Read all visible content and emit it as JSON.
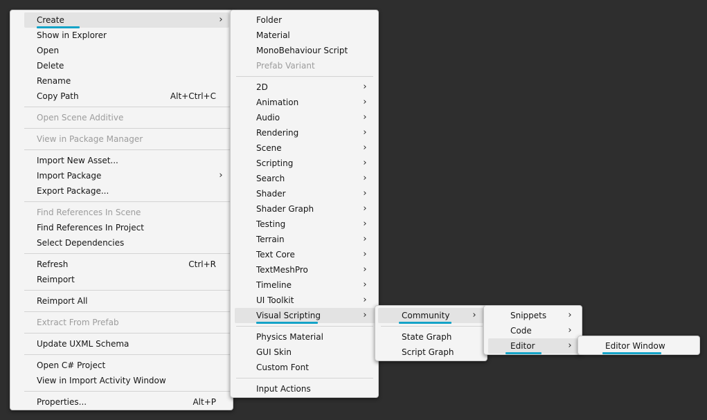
{
  "menus": {
    "main": {
      "items": [
        {
          "label": "Create",
          "submenu": true
        },
        {
          "label": "Show in Explorer"
        },
        {
          "label": "Open"
        },
        {
          "label": "Delete"
        },
        {
          "label": "Rename"
        },
        {
          "label": "Copy Path",
          "shortcut": "Alt+Ctrl+C"
        },
        {
          "label": "Open Scene Additive",
          "disabled": true
        },
        {
          "label": "View in Package Manager",
          "disabled": true
        },
        {
          "label": "Import New Asset..."
        },
        {
          "label": "Import Package",
          "submenu": true
        },
        {
          "label": "Export Package..."
        },
        {
          "label": "Find References In Scene",
          "disabled": true
        },
        {
          "label": "Find References In Project"
        },
        {
          "label": "Select Dependencies"
        },
        {
          "label": "Refresh",
          "shortcut": "Ctrl+R"
        },
        {
          "label": "Reimport"
        },
        {
          "label": "Reimport All"
        },
        {
          "label": "Extract From Prefab",
          "disabled": true
        },
        {
          "label": "Update UXML Schema"
        },
        {
          "label": "Open C# Project"
        },
        {
          "label": "View in Import Activity Window"
        },
        {
          "label": "Properties...",
          "shortcut": "Alt+P"
        }
      ]
    },
    "create": {
      "items": [
        {
          "label": "Folder"
        },
        {
          "label": "Material"
        },
        {
          "label": "MonoBehaviour Script"
        },
        {
          "label": "Prefab Variant",
          "disabled": true
        },
        {
          "label": "2D",
          "submenu": true
        },
        {
          "label": "Animation",
          "submenu": true
        },
        {
          "label": "Audio",
          "submenu": true
        },
        {
          "label": "Rendering",
          "submenu": true
        },
        {
          "label": "Scene",
          "submenu": true
        },
        {
          "label": "Scripting",
          "submenu": true
        },
        {
          "label": "Search",
          "submenu": true
        },
        {
          "label": "Shader",
          "submenu": true
        },
        {
          "label": "Shader Graph",
          "submenu": true
        },
        {
          "label": "Testing",
          "submenu": true
        },
        {
          "label": "Terrain",
          "submenu": true
        },
        {
          "label": "Text Core",
          "submenu": true
        },
        {
          "label": "TextMeshPro",
          "submenu": true
        },
        {
          "label": "Timeline",
          "submenu": true
        },
        {
          "label": "UI Toolkit",
          "submenu": true
        },
        {
          "label": "Visual Scripting",
          "submenu": true
        },
        {
          "label": "Physics Material"
        },
        {
          "label": "GUI Skin"
        },
        {
          "label": "Custom Font"
        },
        {
          "label": "Input Actions"
        }
      ]
    },
    "visual_scripting": {
      "items": [
        {
          "label": "Community",
          "submenu": true
        },
        {
          "label": "State Graph"
        },
        {
          "label": "Script Graph"
        }
      ]
    },
    "community": {
      "items": [
        {
          "label": "Snippets",
          "submenu": true
        },
        {
          "label": "Code",
          "submenu": true
        },
        {
          "label": "Editor",
          "submenu": true
        }
      ]
    },
    "editor": {
      "items": [
        {
          "label": "Editor Window"
        }
      ]
    }
  },
  "icons": {
    "submenu_arrow": "chevron-right-icon"
  },
  "colors": {
    "highlight_underline": "#14a3c7",
    "background": "#2e2e2e",
    "menu_bg": "#f4f4f4"
  }
}
